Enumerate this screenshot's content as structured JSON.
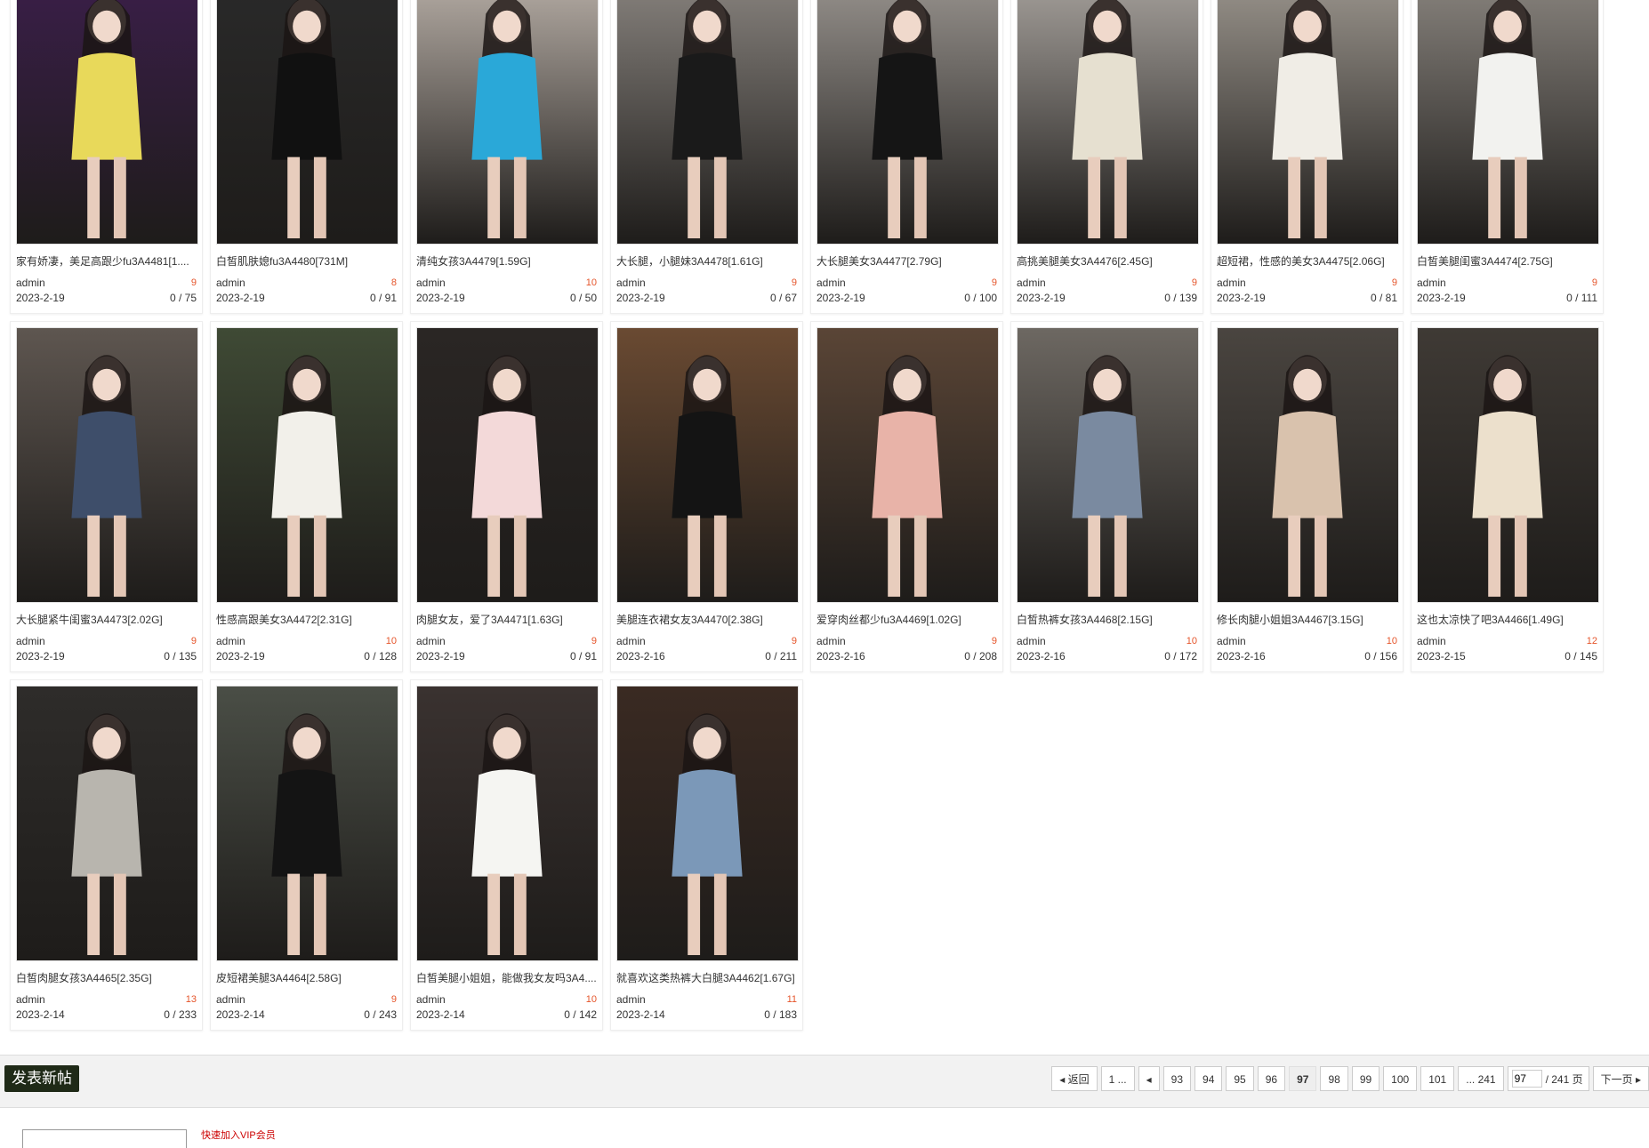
{
  "posts": [
    {
      "title": "家有娇凄，美足高跟少fu3A4481[1....",
      "author": "admin",
      "count": "9",
      "date": "2023-2-19",
      "views": "0 / 75",
      "bg": "#3b1e4a",
      "fg": "#e8d95a"
    },
    {
      "title": "白皙肌肤媳fu3A4480[731M]",
      "author": "admin",
      "count": "8",
      "date": "2023-2-19",
      "views": "0 / 91",
      "bg": "#2a2a2a",
      "fg": "#111111"
    },
    {
      "title": "清纯女孩3A4479[1.59G]",
      "author": "admin",
      "count": "10",
      "date": "2023-2-19",
      "views": "0 / 50",
      "bg": "#b9b0a8",
      "fg": "#2aa8d8"
    },
    {
      "title": "大长腿，小腿妹3A4478[1.61G]",
      "author": "admin",
      "count": "9",
      "date": "2023-2-19",
      "views": "0 / 67",
      "bg": "#8a8580",
      "fg": "#1a1a1a"
    },
    {
      "title": "大长腿美女3A4477[2.79G]",
      "author": "admin",
      "count": "9",
      "date": "2023-2-19",
      "views": "0 / 100",
      "bg": "#9a9590",
      "fg": "#151515"
    },
    {
      "title": "高挑美腿美女3A4476[2.45G]",
      "author": "admin",
      "count": "9",
      "date": "2023-2-19",
      "views": "0 / 139",
      "bg": "#a8a39e",
      "fg": "#e6e0d0"
    },
    {
      "title": "超短裙，性感的美女3A4475[2.06G]",
      "author": "admin",
      "count": "9",
      "date": "2023-2-19",
      "views": "0 / 81",
      "bg": "#9d978f",
      "fg": "#f0ede6"
    },
    {
      "title": "白皙美腿闺蜜3A4474[2.75G]",
      "author": "admin",
      "count": "9",
      "date": "2023-2-19",
      "views": "0 / 111",
      "bg": "#8b8680",
      "fg": "#f2f2ef"
    },
    {
      "title": "大长腿紧牛闺蜜3A4473[2.02G]",
      "author": "admin",
      "count": "9",
      "date": "2023-2-19",
      "views": "0 / 135",
      "bg": "#5e5650",
      "fg": "#3e4e6a"
    },
    {
      "title": "性感高跟美女3A4472[2.31G]",
      "author": "admin",
      "count": "10",
      "date": "2023-2-19",
      "views": "0 / 128",
      "bg": "#3f4a35",
      "fg": "#f2f0ea"
    },
    {
      "title": "肉腿女友，爱了3A4471[1.63G]",
      "author": "admin",
      "count": "9",
      "date": "2023-2-19",
      "views": "0 / 91",
      "bg": "#2a2624",
      "fg": "#f3d9d9"
    },
    {
      "title": "美腿连衣裙女友3A4470[2.38G]",
      "author": "admin",
      "count": "9",
      "date": "2023-2-16",
      "views": "0 / 211",
      "bg": "#6a4a32",
      "fg": "#141414"
    },
    {
      "title": "爱穿肉丝都少fu3A4469[1.02G]",
      "author": "admin",
      "count": "9",
      "date": "2023-2-16",
      "views": "0 / 208",
      "bg": "#5a4536",
      "fg": "#e8b3a8"
    },
    {
      "title": "白皙热裤女孩3A4468[2.15G]",
      "author": "admin",
      "count": "10",
      "date": "2023-2-16",
      "views": "0 / 172",
      "bg": "#6d6862",
      "fg": "#7a8aa0"
    },
    {
      "title": "修长肉腿小姐姐3A4467[3.15G]",
      "author": "admin",
      "count": "10",
      "date": "2023-2-16",
      "views": "0 / 156",
      "bg": "#4a4540",
      "fg": "#d9c2ad"
    },
    {
      "title": "这也太凉快了吧3A4466[1.49G]",
      "author": "admin",
      "count": "12",
      "date": "2023-2-15",
      "views": "0 / 145",
      "bg": "#3f3a35",
      "fg": "#ece0cc"
    },
    {
      "title": "白皙肉腿女孩3A4465[2.35G]",
      "author": "admin",
      "count": "13",
      "date": "2023-2-14",
      "views": "0 / 233",
      "bg": "#2e2c2a",
      "fg": "#b8b5ae"
    },
    {
      "title": "皮短裙美腿3A4464[2.58G]",
      "author": "admin",
      "count": "9",
      "date": "2023-2-14",
      "views": "0 / 243",
      "bg": "#4a4e46",
      "fg": "#141414"
    },
    {
      "title": "白皙美腿小姐姐，能做我女友吗3A4....",
      "author": "admin",
      "count": "10",
      "date": "2023-2-14",
      "views": "0 / 142",
      "bg": "#3a3230",
      "fg": "#f5f5f2"
    },
    {
      "title": "就喜欢这类热裤大白腿3A4462[1.67G]",
      "author": "admin",
      "count": "11",
      "date": "2023-2-14",
      "views": "0 / 183",
      "bg": "#3a2a22",
      "fg": "#7b98b8"
    }
  ],
  "toolbar": {
    "post_button": "发表新帖"
  },
  "pagination": {
    "back": "返回",
    "first": "1 ...",
    "pages": [
      "93",
      "94",
      "95",
      "96",
      "97",
      "98",
      "99",
      "100",
      "101"
    ],
    "current": "97",
    "last": "... 241",
    "input_value": "97",
    "total": "/ 241 页",
    "next": "下一页"
  },
  "footer": {
    "notice": "快速加入VIP会员"
  }
}
